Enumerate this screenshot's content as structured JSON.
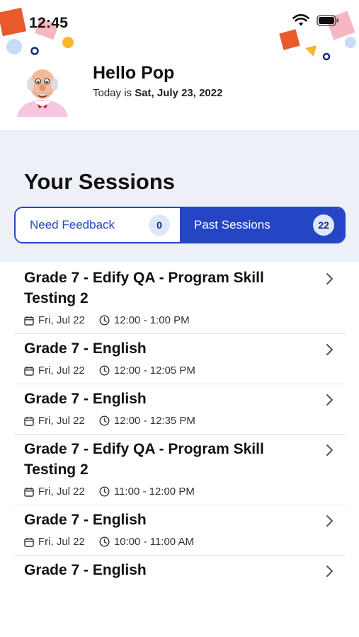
{
  "status_bar": {
    "time": "12:45"
  },
  "header": {
    "greeting": "Hello Pop",
    "date_prefix": "Today is ",
    "date_value": "Sat, July 23, 2022"
  },
  "sessions": {
    "title": "Your Sessions",
    "tabs": [
      {
        "label": "Need Feedback",
        "count": "0",
        "selected": false
      },
      {
        "label": "Past Sessions",
        "count": "22",
        "selected": true
      }
    ],
    "items": [
      {
        "title": "Grade 7 - Edify QA - Program Skill Testing 2",
        "date": "Fri, Jul 22",
        "time": "12:00 - 1:00 PM"
      },
      {
        "title": "Grade 7 - English",
        "date": "Fri, Jul 22",
        "time": "12:00 - 12:05 PM"
      },
      {
        "title": "Grade 7 - English",
        "date": "Fri, Jul 22",
        "time": "12:00 - 12:35 PM"
      },
      {
        "title": "Grade 7 - Edify QA - Program Skill Testing 2",
        "date": "Fri, Jul 22",
        "time": "11:00 - 12:00 PM"
      },
      {
        "title": "Grade 7 - English",
        "date": "Fri, Jul 22",
        "time": "10:00 - 11:00 AM"
      },
      {
        "title": "Grade 7 - English",
        "date": "",
        "time": ""
      }
    ]
  },
  "colors": {
    "accent": "#2546c4",
    "panel_bg": "#eef0f8",
    "badge_bg": "#dfe7fb"
  },
  "icons": [
    "wifi-icon",
    "battery-icon",
    "calendar-icon",
    "clock-icon",
    "chevron-right-icon"
  ]
}
